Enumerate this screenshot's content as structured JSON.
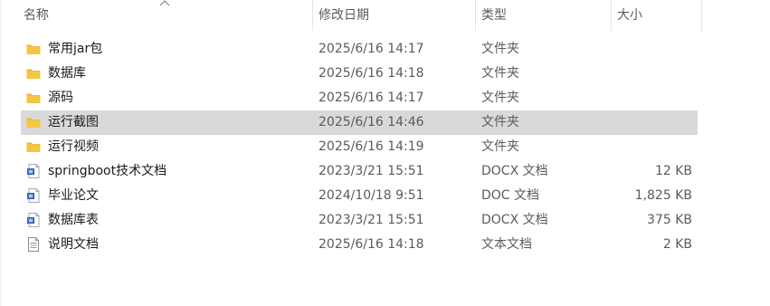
{
  "columns": {
    "name": "名称",
    "date": "修改日期",
    "type": "类型",
    "size": "大小"
  },
  "files": [
    {
      "name": "常用jar包",
      "date": "2025/6/16 14:17",
      "type": "文件夹",
      "size": "",
      "icon": "folder-icon",
      "selected": false
    },
    {
      "name": "数据库",
      "date": "2025/6/16 14:18",
      "type": "文件夹",
      "size": "",
      "icon": "folder-icon",
      "selected": false
    },
    {
      "name": "源码",
      "date": "2025/6/16 14:17",
      "type": "文件夹",
      "size": "",
      "icon": "folder-icon",
      "selected": false
    },
    {
      "name": "运行截图",
      "date": "2025/6/16 14:46",
      "type": "文件夹",
      "size": "",
      "icon": "folder-icon",
      "selected": true
    },
    {
      "name": "运行视频",
      "date": "2025/6/16 14:19",
      "type": "文件夹",
      "size": "",
      "icon": "folder-icon",
      "selected": false
    },
    {
      "name": "springboot技术文档",
      "date": "2023/3/21 15:51",
      "type": "DOCX 文档",
      "size": "12 KB",
      "icon": "word-document-icon",
      "selected": false
    },
    {
      "name": "毕业论文",
      "date": "2024/10/18 9:51",
      "type": "DOC 文档",
      "size": "1,825 KB",
      "icon": "word-document-icon",
      "selected": false
    },
    {
      "name": "数据库表",
      "date": "2023/3/21 15:51",
      "type": "DOCX 文档",
      "size": "375 KB",
      "icon": "word-document-icon",
      "selected": false
    },
    {
      "name": "说明文档",
      "date": "2025/6/16 14:18",
      "type": "文本文档",
      "size": "2 KB",
      "icon": "text-document-icon",
      "selected": false
    }
  ],
  "colors": {
    "selected_row": "#d9d9d9",
    "folder": "#f6c544",
    "word_blue": "#2b5fb8"
  }
}
